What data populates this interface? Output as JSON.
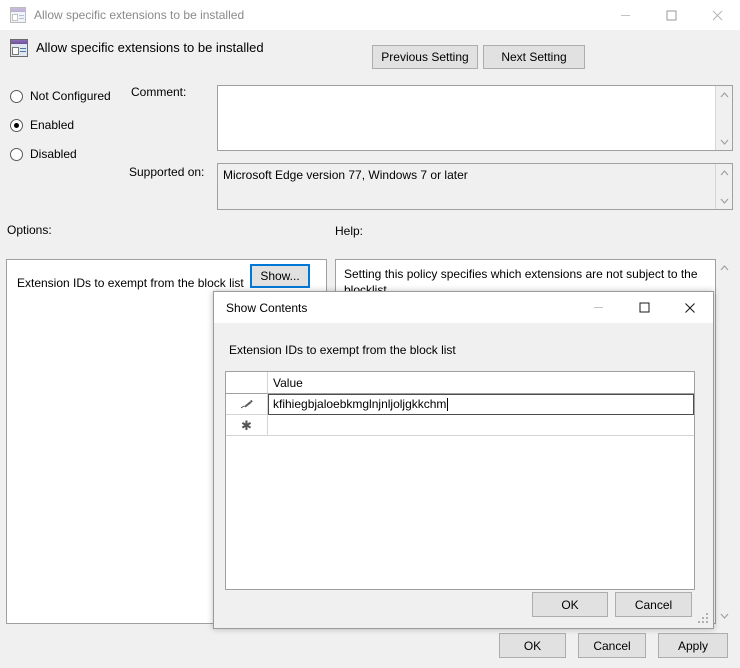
{
  "window": {
    "title": "Allow specific extensions to be installed",
    "icon": "policy-window-icon",
    "minimize": "–",
    "maximize": "□",
    "close": "✕"
  },
  "header": {
    "title": "Allow specific extensions to be installed",
    "previous_setting": "Previous Setting",
    "next_setting": "Next Setting"
  },
  "state": {
    "options": [
      "Not Configured",
      "Enabled",
      "Disabled"
    ],
    "selected": "Enabled"
  },
  "radios": [
    {
      "label": "Not Configured",
      "checked": false
    },
    {
      "label": "Enabled",
      "checked": true
    },
    {
      "label": "Disabled",
      "checked": false
    }
  ],
  "comment": {
    "label": "Comment:",
    "value": "",
    "placeholder": ""
  },
  "supported": {
    "label": "Supported on:",
    "value": "Microsoft Edge version 77, Windows 7 or later"
  },
  "panels": {
    "options_label": "Options:",
    "help_label": "Help:"
  },
  "options": {
    "setting_label": "Extension IDs to exempt from the block list",
    "show_button": "Show...",
    "show_button_focus_color": "#0078d7"
  },
  "help": {
    "text": "Setting this policy specifies which extensions are not subject to the blocklist."
  },
  "footer": {
    "ok": "OK",
    "cancel": "Cancel",
    "apply": "Apply"
  },
  "modal": {
    "title": "Show Contents",
    "minimize": "–",
    "maximize": "□",
    "close": "✕",
    "sublabel": "Extension IDs to exempt from the block list",
    "grid": {
      "columns": [
        "",
        "Value"
      ],
      "rows": [
        {
          "indicator": "pencil-icon",
          "value": "kfihiegbjaloebkmglnjnljoljgkkchm",
          "editing": true
        },
        {
          "indicator": "new-row-asterisk",
          "value": "",
          "editing": false
        }
      ]
    },
    "ok": "OK",
    "cancel": "Cancel"
  },
  "scroll": {
    "up": "▲",
    "down": "▼"
  }
}
